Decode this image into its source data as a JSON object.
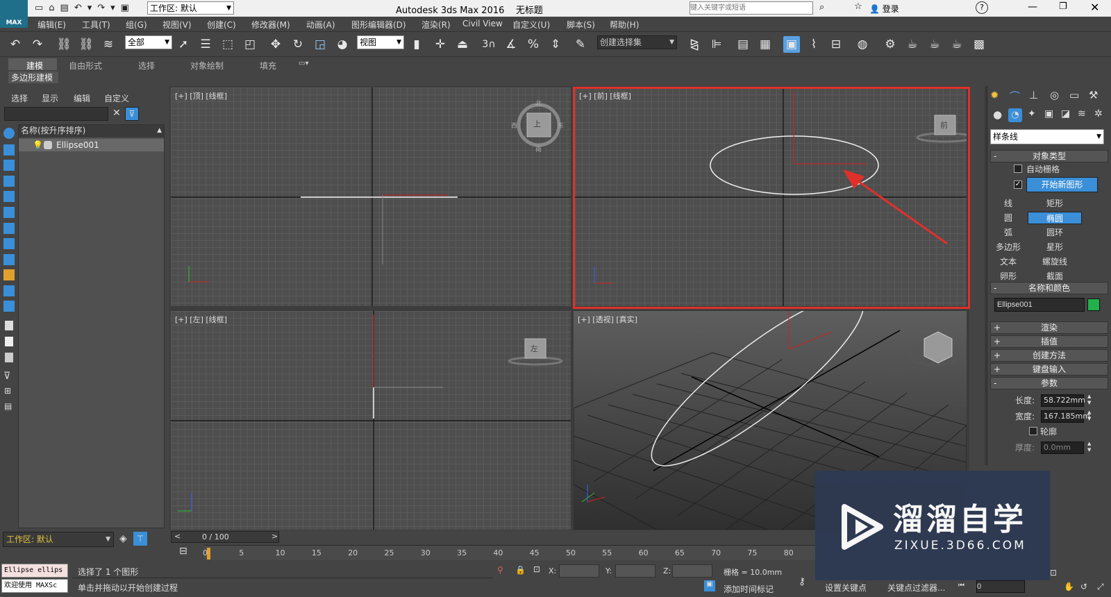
{
  "app": {
    "title": "Autodesk 3ds Max 2016",
    "doc": "无标题",
    "logo": "MAX",
    "workspace": "工作区: 默认",
    "search_placeholder": "键入关键字或短语",
    "login": "登录"
  },
  "menus": [
    "编辑(E)",
    "工具(T)",
    "组(G)",
    "视图(V)",
    "创建(C)",
    "修改器(M)",
    "动画(A)",
    "图形编辑器(D)",
    "渲染(R)",
    "Civil View",
    "自定义(U)",
    "脚本(S)",
    "帮助(H)"
  ],
  "toolbar": {
    "filter": "全部",
    "refcoord": "视图",
    "selset": "创建选择集",
    "snap_count": "3"
  },
  "ribbon": {
    "tabs": [
      "建模",
      "自由形式",
      "选择",
      "对象绘制",
      "填充"
    ],
    "subtab": "多边形建模"
  },
  "scene": {
    "tabs": [
      "选择",
      "显示",
      "编辑",
      "自定义"
    ],
    "col_header": "名称(按升序排序)",
    "object": "Ellipse001",
    "workspace": "工作区: 默认"
  },
  "viewports": {
    "top": "[+] [顶] [线框]",
    "front": "[+] [前] [线框]",
    "left": "[+] [左] [线框]",
    "persp": "[+] [透视] [真实]",
    "cube_top": "上",
    "cube_front": "前",
    "cube_left": "左",
    "compass": {
      "n": "北",
      "s": "南",
      "e": "东",
      "w": "西"
    }
  },
  "axes": {
    "x": "x",
    "y": "y",
    "z": "z"
  },
  "command": {
    "category": "样条线",
    "rollouts": {
      "object_type": "对象类型",
      "name_color": "名称和颜色",
      "render": "渲染",
      "interp": "插值",
      "create_method": "创建方法",
      "keyboard": "键盘输入",
      "params": "参数"
    },
    "auto_grid": "自动栅格",
    "start_new": "开始新图形",
    "buttons": [
      "线",
      "矩形",
      "圆",
      "椭圆",
      "弧",
      "圆环",
      "多边形",
      "星形",
      "文本",
      "螺旋线",
      "卵形",
      "截面"
    ],
    "active_button": "椭圆",
    "name": "Ellipse001",
    "object_color": "#22b14c",
    "length_label": "长度:",
    "length": "58.722mm",
    "width_label": "宽度:",
    "width": "167.185mm",
    "outline": "轮廓",
    "thickness_label": "厚度:",
    "thickness": "0.0mm"
  },
  "timeline": {
    "frame": "0 / 100",
    "ticks": [
      "0",
      "5",
      "10",
      "15",
      "20",
      "25",
      "30",
      "35",
      "40",
      "45",
      "50",
      "55",
      "60",
      "65",
      "70",
      "75",
      "80"
    ]
  },
  "status": {
    "maxscript_top": "Ellipse ellips",
    "maxscript_bottom": "欢迎使用 MAXSc",
    "selected": "选择了 1 个图形",
    "prompt": "单击并拖动以开始创建过程",
    "x_label": "X:",
    "y_label": "Y:",
    "z_label": "Z:",
    "grid": "栅格 = 10.0mm",
    "add_time_tag": "添加时间标记",
    "set_key": "设置关键点",
    "key_filters": "关键点过滤器...",
    "frame_input": "0"
  },
  "watermark": {
    "cn": "溜溜自学",
    "url": "ZIXUE.3D66.COM"
  },
  "colors": {
    "highlight": "#e0302a",
    "active_blue": "#3a8fd8"
  }
}
